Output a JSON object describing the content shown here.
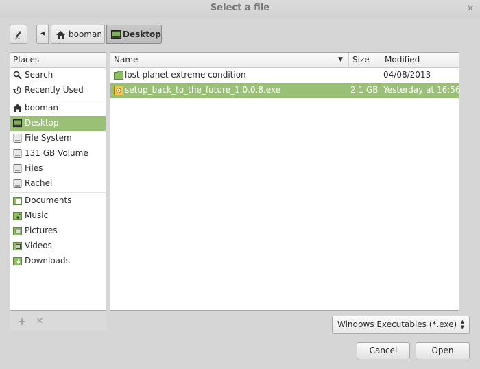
{
  "window": {
    "title": "Select a file"
  },
  "toolbar": {
    "path": [
      {
        "label": "booman",
        "icon": "home-icon"
      },
      {
        "label": "Desktop",
        "icon": "desktop-icon",
        "active": true
      }
    ]
  },
  "places": {
    "header": "Places",
    "items": [
      {
        "label": "Search",
        "icon": "search-icon"
      },
      {
        "label": "Recently Used",
        "icon": "recent-icon"
      },
      {
        "label": "booman",
        "icon": "home-icon"
      },
      {
        "label": "Desktop",
        "icon": "desktop-icon",
        "selected": true
      },
      {
        "label": "File System",
        "icon": "drive-icon"
      },
      {
        "label": "131 GB Volume",
        "icon": "drive-icon"
      },
      {
        "label": "Files",
        "icon": "drive-icon"
      },
      {
        "label": "Rachel",
        "icon": "drive-icon"
      },
      {
        "label": "Documents",
        "icon": "folder-documents-icon"
      },
      {
        "label": "Music",
        "icon": "folder-music-icon"
      },
      {
        "label": "Pictures",
        "icon": "folder-pictures-icon"
      },
      {
        "label": "Videos",
        "icon": "folder-videos-icon"
      },
      {
        "label": "Downloads",
        "icon": "folder-downloads-icon"
      }
    ]
  },
  "files": {
    "columns": {
      "name": "Name",
      "size": "Size",
      "modified": "Modified"
    },
    "rows": [
      {
        "name": "lost planet extreme condition",
        "size": "",
        "modified": "04/08/2013",
        "icon": "folder-icon"
      },
      {
        "name": "setup_back_to_the_future_1.0.0.8.exe",
        "size": "2.1 GB",
        "modified": "Yesterday at 16:56",
        "icon": "exe-icon",
        "selected": true
      }
    ]
  },
  "filter": {
    "selected": "Windows Executables (*.exe)"
  },
  "buttons": {
    "cancel": "Cancel",
    "open": "Open"
  },
  "colors": {
    "selection": "#9ac076",
    "background": "#d6d6d6",
    "folder": "#7fb058"
  }
}
